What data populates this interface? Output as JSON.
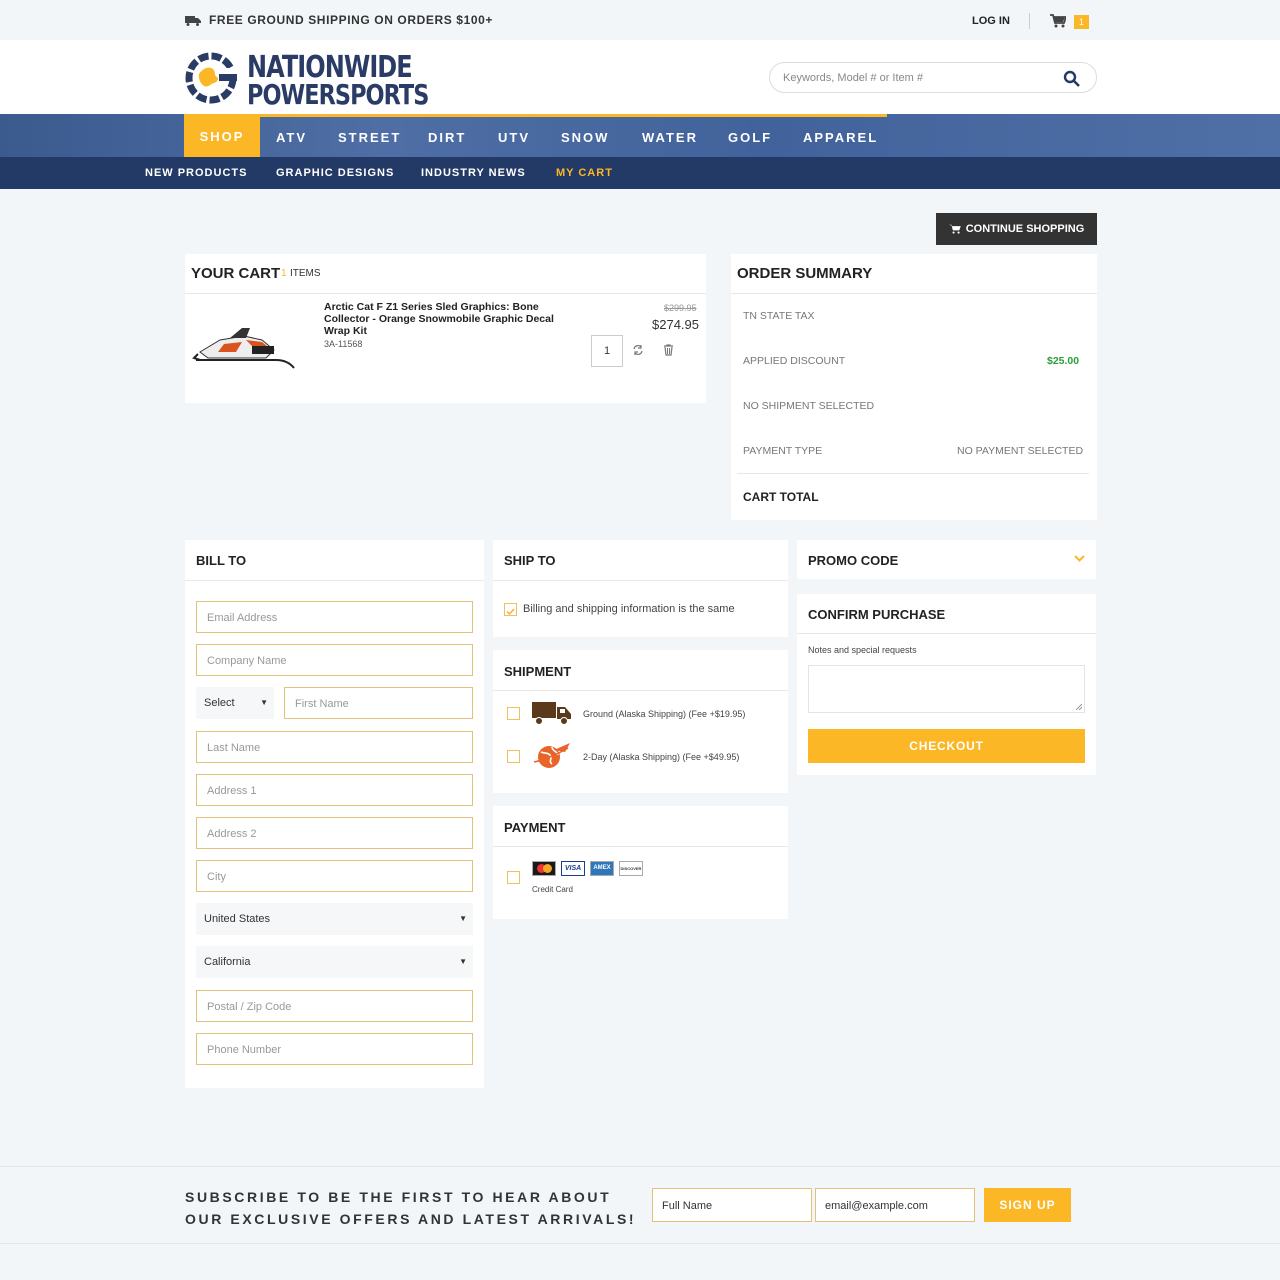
{
  "topbar": {
    "shipping_text": "FREE GROUND SHIPPING ON ORDERS $100+",
    "login_label": "LOG IN",
    "cart_count": "1"
  },
  "header": {
    "logo_line1": "NATIONWIDE",
    "logo_line2": "POWERSPORTS",
    "search_placeholder": "Keywords, Model # or Item #"
  },
  "main_nav": [
    "SHOP",
    "ATV",
    "STREET",
    "DIRT",
    "UTV",
    "SNOW",
    "WATER",
    "GOLF",
    "APPAREL"
  ],
  "sub_nav": [
    "NEW PRODUCTS",
    "GRAPHIC DESIGNS",
    "INDUSTRY NEWS",
    "MY CART"
  ],
  "continue_label": "CONTINUE SHOPPING",
  "cart": {
    "title": "YOUR CART",
    "count": "1",
    "count_label": "ITEMS",
    "item": {
      "name_line1": "Arctic Cat F Z1 Series Sled Graphics: Bone",
      "name_line2": "Collector - Orange Snowmobile Graphic Decal",
      "name_line3": "Wrap Kit",
      "sku": "3A-11568",
      "qty": "1",
      "old_price": "$299.95",
      "price": "$274.95"
    }
  },
  "summary": {
    "title": "ORDER SUMMARY",
    "tax_label": "TN STATE TAX",
    "discount_label": "APPLIED DISCOUNT",
    "discount_value": "$25.00",
    "shipment_label": "NO SHIPMENT SELECTED",
    "payment_label": "PAYMENT TYPE",
    "payment_value": "NO PAYMENT SELECTED",
    "total_label": "CART TOTAL"
  },
  "bill_to": {
    "title": "BILL TO",
    "email": "Email Address",
    "company": "Company Name",
    "prefix": "Select",
    "first": "First Name",
    "last": "Last Name",
    "addr1": "Address 1",
    "addr2": "Address 2",
    "city": "City",
    "country": "United States",
    "state": "California",
    "zip": "Postal / Zip Code",
    "phone": "Phone Number"
  },
  "ship_to": {
    "title": "SHIP TO",
    "same_label": "Billing and shipping information is the same"
  },
  "shipment": {
    "title": "SHIPMENT",
    "option1": "Ground (Alaska Shipping) (Fee +$19.95)",
    "option2": "2-Day (Alaska Shipping) (Fee +$49.95)"
  },
  "payment": {
    "title": "PAYMENT",
    "cards": [
      "MasterCard",
      "VISA",
      "AMEX",
      "DISCOVER"
    ],
    "credit_label": "Credit Card"
  },
  "promo": {
    "title": "PROMO CODE"
  },
  "confirm": {
    "title": "CONFIRM PURCHASE",
    "notes_label": "Notes and special requests",
    "checkout_label": "CHECKOUT"
  },
  "subscribe": {
    "line1": "SUBSCRIBE TO BE THE FIRST TO HEAR ABOUT",
    "line2": "OUR EXCLUSIVE OFFERS AND LATEST ARRIVALS!",
    "name_placeholder": "Full Name",
    "email_placeholder": "email@example.com",
    "button": "SIGN UP"
  },
  "colors": {
    "accent": "#fbb726",
    "navy": "#243a66",
    "green": "#2a9d3a"
  }
}
